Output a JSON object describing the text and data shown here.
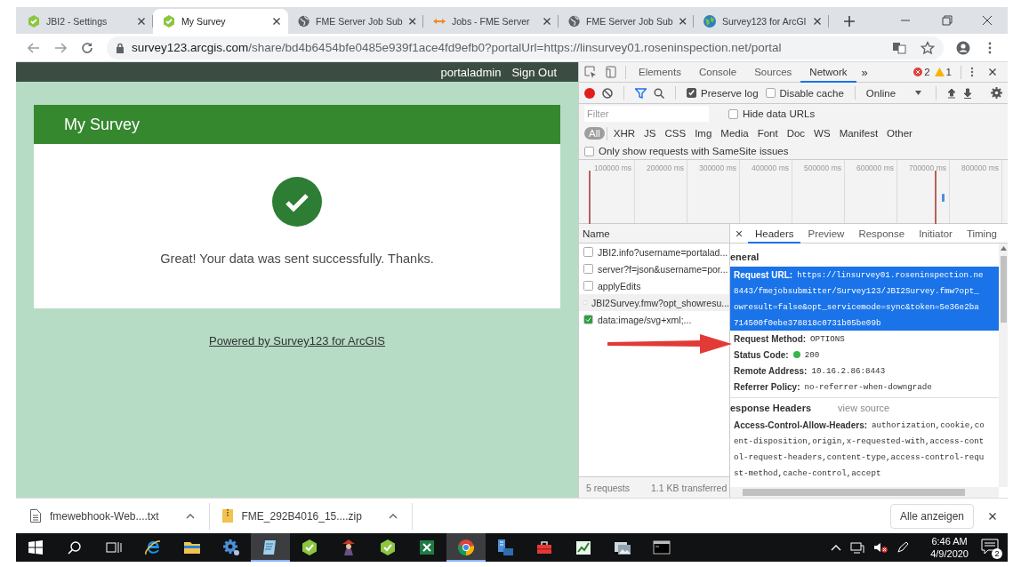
{
  "browser_tabs": [
    {
      "title": "JBI2 - Settings",
      "kind": "survey",
      "selected": false
    },
    {
      "title": "My Survey",
      "kind": "survey",
      "selected": true
    },
    {
      "title": "FME Server Job Sub",
      "kind": "globe",
      "selected": false
    },
    {
      "title": "Jobs - FME Server",
      "kind": "fme",
      "selected": false
    },
    {
      "title": "FME Server Job Sub",
      "kind": "globe",
      "selected": false
    },
    {
      "title": "Survey123 for ArcGI",
      "kind": "arcgis",
      "selected": false
    }
  ],
  "address_bar": {
    "host": "survey123.arcgis.com",
    "path": "/share/bd4b6454bfe0485e939f1ace4fd9efb0?portalUrl=https://linsurvey01.roseninspection.net/portal"
  },
  "survey_page": {
    "user": "portaladmin",
    "sign_out": "Sign Out",
    "title": "My Survey",
    "message": "Great! Your data was sent successfully. Thanks.",
    "powered_by": "Powered by Survey123 for ArcGIS"
  },
  "devtools": {
    "tabs": [
      {
        "label": "Elements",
        "selected": false
      },
      {
        "label": "Console",
        "selected": false
      },
      {
        "label": "Sources",
        "selected": false
      },
      {
        "label": "Network",
        "selected": true
      }
    ],
    "more_tabs": "»",
    "error_count": "2",
    "warning_count": "1",
    "recording": true,
    "preserve_log": {
      "label": "Preserve log",
      "checked": true
    },
    "disable_cache": {
      "label": "Disable cache",
      "checked": false
    },
    "throttling": "Online",
    "filter": {
      "placeholder": "Filter"
    },
    "hide_data_urls": {
      "label": "Hide data URLs",
      "checked": false
    },
    "type_filters": [
      {
        "label": "All",
        "selected": true
      },
      {
        "label": "XHR",
        "selected": false
      },
      {
        "label": "JS",
        "selected": false
      },
      {
        "label": "CSS",
        "selected": false
      },
      {
        "label": "Img",
        "selected": false
      },
      {
        "label": "Media",
        "selected": false
      },
      {
        "label": "Font",
        "selected": false
      },
      {
        "label": "Doc",
        "selected": false
      },
      {
        "label": "WS",
        "selected": false
      },
      {
        "label": "Manifest",
        "selected": false
      },
      {
        "label": "Other",
        "selected": false
      }
    ],
    "samesite_only": {
      "label": "Only show requests with SameSite issues",
      "checked": false
    },
    "timeline_ticks": [
      "100000 ms",
      "200000 ms",
      "300000 ms",
      "400000 ms",
      "500000 ms",
      "600000 ms",
      "700000 ms",
      "800000 ms"
    ],
    "requests": {
      "column": "Name",
      "rows": [
        {
          "name": "JBI2.info?username=portalad...",
          "kind": "doc",
          "selected": false
        },
        {
          "name": "server?f=json&username=por...",
          "kind": "doc",
          "selected": false
        },
        {
          "name": "applyEdits",
          "kind": "doc",
          "selected": false
        },
        {
          "name": "JBI2Survey.fmw?opt_showresu...",
          "kind": "doc",
          "selected": true
        },
        {
          "name": "data:image/svg+xml;...",
          "kind": "image",
          "selected": false
        }
      ]
    },
    "summary": [
      "5 requests",
      "1.1 KB transferred"
    ],
    "detail_tabs": [
      {
        "label": "Headers",
        "selected": true
      },
      {
        "label": "Preview",
        "selected": false
      },
      {
        "label": "Response",
        "selected": false
      },
      {
        "label": "Initiator",
        "selected": false
      },
      {
        "label": "Timing",
        "selected": false
      }
    ],
    "general": {
      "heading": "eneral",
      "fields": [
        {
          "label": "Request URL:",
          "kind": "text",
          "selected": true,
          "value_lines": [
            "https://linsurvey01.roseninspection.ne",
            "8443/fmejobsubmitter/Survey123/JBI2Survey.fmw?opt_",
            "owresult=false&opt_servicemode=sync&token=5e36e2ba",
            "714500f0ebe378818c0731b05be09b"
          ]
        },
        {
          "label": "Request Method:",
          "kind": "text",
          "selected": false,
          "value_lines": [
            "OPTIONS"
          ]
        },
        {
          "label": "Status Code:",
          "kind": "status",
          "selected": false,
          "value_lines": [
            "200"
          ]
        },
        {
          "label": "Remote Address:",
          "kind": "text",
          "selected": false,
          "value_lines": [
            "10.16.2.86:8443"
          ]
        },
        {
          "label": "Referrer Policy:",
          "kind": "text",
          "selected": false,
          "value_lines": [
            "no-referrer-when-downgrade"
          ]
        }
      ]
    },
    "response_headers": {
      "heading": "esponse Headers",
      "view_source": "view source",
      "fields": [
        {
          "label": "Access-Control-Allow-Headers:",
          "kind": "text",
          "selected": false,
          "value_lines": [
            "authorization,cookie,co",
            "ent-disposition,origin,x-requested-with,access-cont",
            "ol-request-headers,content-type,access-control-requ",
            "st-method,cache-control,accept"
          ]
        }
      ]
    }
  },
  "downloads": {
    "items": [
      {
        "name": "fmewebhook-Web....txt",
        "kind": "text"
      },
      {
        "name": "FME_292B4016_15....zip",
        "kind": "zip"
      }
    ],
    "show_all": "Alle anzeigen"
  },
  "taskbar": {
    "apps": [
      {
        "kind": "ie",
        "selected": false
      },
      {
        "kind": "folder",
        "selected": false
      },
      {
        "kind": "gear",
        "selected": false
      },
      {
        "kind": "notepad",
        "selected": true
      },
      {
        "kind": "survey",
        "selected": false
      },
      {
        "kind": "figure",
        "selected": false
      },
      {
        "kind": "survey",
        "selected": false
      },
      {
        "kind": "excel",
        "selected": false
      },
      {
        "kind": "chrome",
        "selected": true
      },
      {
        "kind": "server",
        "selected": false
      },
      {
        "kind": "toolbox",
        "selected": false
      },
      {
        "kind": "chart",
        "selected": false
      },
      {
        "kind": "photos",
        "selected": false
      },
      {
        "kind": "console",
        "selected": false
      }
    ],
    "time": "6:46 AM",
    "date": "4/9/2020",
    "notification_count": "2"
  }
}
